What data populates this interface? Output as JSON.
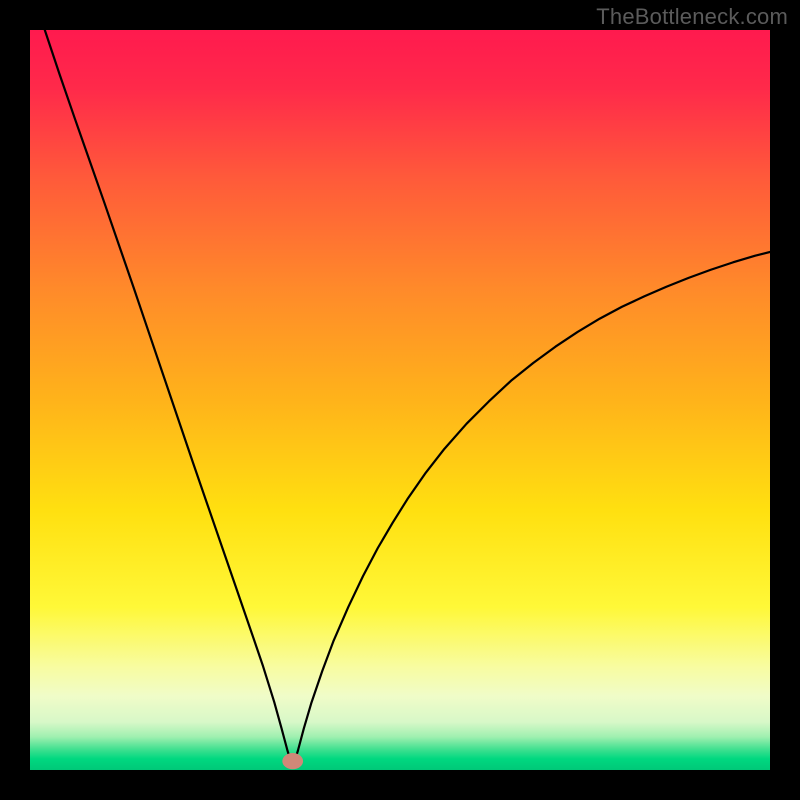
{
  "watermark": "TheBottleneck.com",
  "chart_data": {
    "type": "line",
    "title": "",
    "xlabel": "",
    "ylabel": "",
    "xlim": [
      0,
      100
    ],
    "ylim": [
      0,
      100
    ],
    "legend": null,
    "annotations": [],
    "gradient_stops": [
      {
        "offset": 0.0,
        "color": "#ff1a4e"
      },
      {
        "offset": 0.08,
        "color": "#ff2a4a"
      },
      {
        "offset": 0.2,
        "color": "#ff5a3a"
      },
      {
        "offset": 0.35,
        "color": "#ff8a2a"
      },
      {
        "offset": 0.5,
        "color": "#ffb31a"
      },
      {
        "offset": 0.65,
        "color": "#ffe010"
      },
      {
        "offset": 0.78,
        "color": "#fff838"
      },
      {
        "offset": 0.86,
        "color": "#f8fca0"
      },
      {
        "offset": 0.9,
        "color": "#f0fcc8"
      },
      {
        "offset": 0.935,
        "color": "#d8f8c8"
      },
      {
        "offset": 0.955,
        "color": "#a0f0b0"
      },
      {
        "offset": 0.972,
        "color": "#40e090"
      },
      {
        "offset": 0.985,
        "color": "#00d880"
      },
      {
        "offset": 1.0,
        "color": "#00c878"
      }
    ],
    "curve_color": "#000000",
    "curve_width": 2.2,
    "marker": {
      "x": 35.5,
      "y": 1.2,
      "rx": 1.4,
      "ry": 1.1,
      "fill": "#d08878"
    },
    "series": [
      {
        "name": "curve",
        "points": [
          {
            "x": 2.0,
            "y": 100.0
          },
          {
            "x": 4.0,
            "y": 94.0
          },
          {
            "x": 6.0,
            "y": 88.2
          },
          {
            "x": 8.0,
            "y": 82.5
          },
          {
            "x": 10.0,
            "y": 76.8
          },
          {
            "x": 12.0,
            "y": 71.0
          },
          {
            "x": 14.0,
            "y": 65.2
          },
          {
            "x": 16.0,
            "y": 59.3
          },
          {
            "x": 18.0,
            "y": 53.4
          },
          {
            "x": 20.0,
            "y": 47.5
          },
          {
            "x": 22.0,
            "y": 41.6
          },
          {
            "x": 24.0,
            "y": 35.8
          },
          {
            "x": 26.0,
            "y": 30.0
          },
          {
            "x": 28.0,
            "y": 24.2
          },
          {
            "x": 30.0,
            "y": 18.4
          },
          {
            "x": 31.5,
            "y": 14.0
          },
          {
            "x": 33.0,
            "y": 9.2
          },
          {
            "x": 34.0,
            "y": 5.6
          },
          {
            "x": 34.8,
            "y": 2.6
          },
          {
            "x": 35.3,
            "y": 1.0
          },
          {
            "x": 35.5,
            "y": 0.5
          },
          {
            "x": 35.7,
            "y": 1.0
          },
          {
            "x": 36.2,
            "y": 2.6
          },
          {
            "x": 37.0,
            "y": 5.6
          },
          {
            "x": 38.0,
            "y": 9.0
          },
          {
            "x": 39.5,
            "y": 13.4
          },
          {
            "x": 41.0,
            "y": 17.4
          },
          {
            "x": 43.0,
            "y": 22.0
          },
          {
            "x": 45.0,
            "y": 26.2
          },
          {
            "x": 47.0,
            "y": 30.0
          },
          {
            "x": 49.0,
            "y": 33.4
          },
          {
            "x": 51.0,
            "y": 36.6
          },
          {
            "x": 53.5,
            "y": 40.2
          },
          {
            "x": 56.0,
            "y": 43.4
          },
          {
            "x": 59.0,
            "y": 46.8
          },
          {
            "x": 62.0,
            "y": 49.8
          },
          {
            "x": 65.0,
            "y": 52.6
          },
          {
            "x": 68.0,
            "y": 55.0
          },
          {
            "x": 71.0,
            "y": 57.2
          },
          {
            "x": 74.0,
            "y": 59.2
          },
          {
            "x": 77.0,
            "y": 61.0
          },
          {
            "x": 80.0,
            "y": 62.6
          },
          {
            "x": 83.0,
            "y": 64.0
          },
          {
            "x": 86.0,
            "y": 65.3
          },
          {
            "x": 89.0,
            "y": 66.5
          },
          {
            "x": 92.0,
            "y": 67.6
          },
          {
            "x": 95.0,
            "y": 68.6
          },
          {
            "x": 98.0,
            "y": 69.5
          },
          {
            "x": 100.0,
            "y": 70.0
          }
        ]
      }
    ]
  }
}
